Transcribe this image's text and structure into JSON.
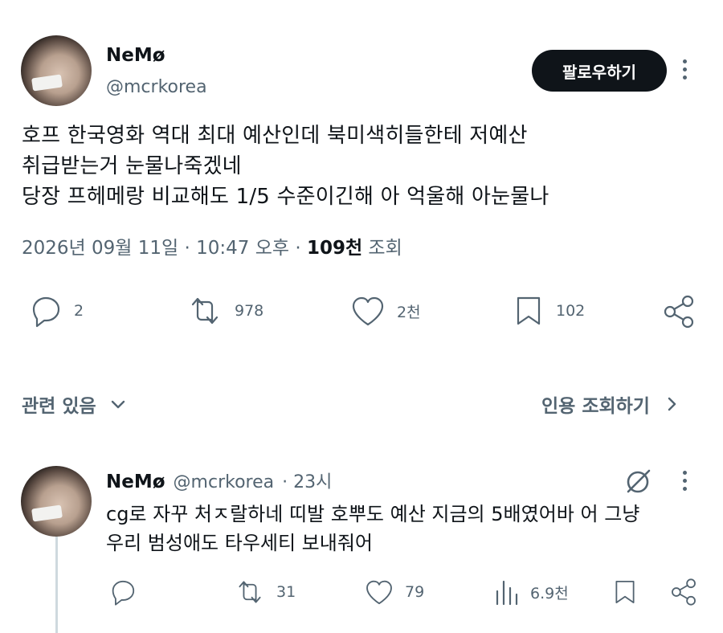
{
  "post": {
    "author_name": "NeMø",
    "author_handle": "@mcrkorea",
    "follow_label": "팔로우하기",
    "text": "호프 한국영화 역대 최대 예산인데 북미색히들한테 저예산\n취급받는거 눈물나죽겠네\n당장 프헤메랑 비교해도 1/5 수준이긴해 아 억울해 아눈물나",
    "date": "2026년 09월 11일 · 10:47 오후 · ",
    "views_count": "109천",
    "views_label": " 조회",
    "stats": {
      "replies": "2",
      "reposts": "978",
      "likes": "2천",
      "bookmarks": "102"
    }
  },
  "related": {
    "label": "관련 있음",
    "quotes_label": "인용 조회하기"
  },
  "reply": {
    "author_name": "NeMø",
    "author_handle": "@mcrkorea",
    "time": "· 23시",
    "text": "cg로 자꾸 처ㅈ랄하네 띠발 호뿌도 예산 지금의 5배였어바 어 그냥\n우리 범성애도 타우세티 보내줘어",
    "stats": {
      "replies": "",
      "reposts": "31",
      "likes": "79",
      "views": "6.9천"
    }
  },
  "icons": [
    "reply-icon",
    "repost-icon",
    "like-icon",
    "bookmark-icon",
    "share-icon",
    "chevron-down-icon",
    "chevron-right-icon",
    "grok-icon",
    "more-icon",
    "views-icon"
  ]
}
